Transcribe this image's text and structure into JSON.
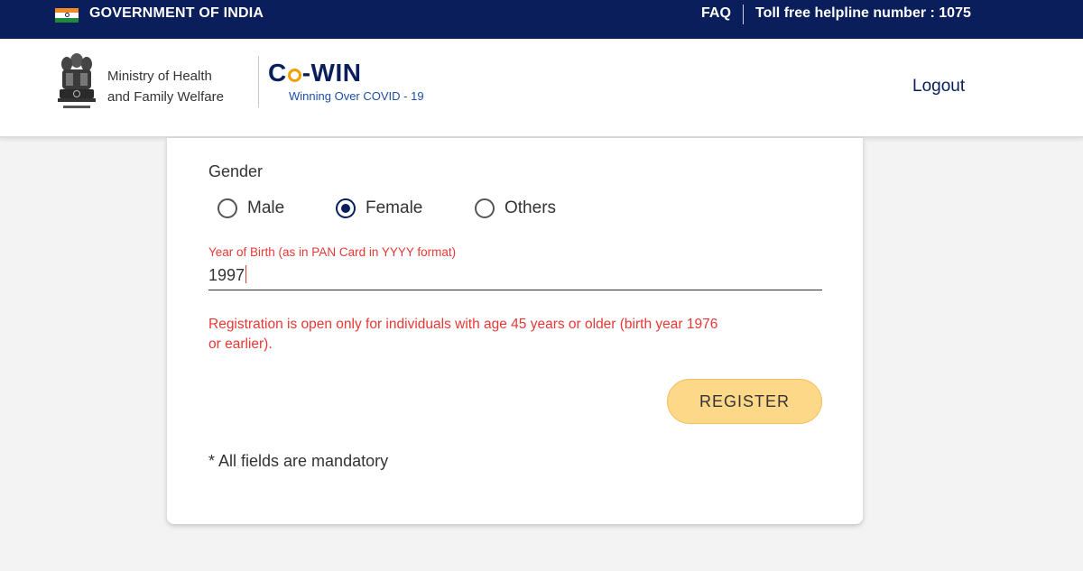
{
  "topbar": {
    "title": "GOVERNMENT OF INDIA",
    "faq": "FAQ",
    "helpline": "Toll free helpline number : 1075"
  },
  "header": {
    "ministry_line1": "Ministry of Health",
    "ministry_line2": "and Family Welfare",
    "logo_prefix": "C",
    "logo_suffix": "-WIN",
    "tagline": "Winning Over COVID - 19",
    "logout": "Logout"
  },
  "form": {
    "gender_label": "Gender",
    "gender_options": [
      {
        "label": "Male",
        "checked": false
      },
      {
        "label": "Female",
        "checked": true
      },
      {
        "label": "Others",
        "checked": false
      }
    ],
    "yob_label": "Year of Birth (as in PAN Card in YYYY format)",
    "yob_value": "1997",
    "error_line1": "Registration is open only for individuals with age 45 years or older (birth year 1976",
    "error_line2": "or earlier).",
    "register_label": "REGISTER",
    "mandatory_note": "* All fields are mandatory"
  },
  "colors": {
    "navy": "#0a1e5c",
    "error": "#e53935",
    "button": "#fcd888",
    "background": "#f3f3f3"
  }
}
